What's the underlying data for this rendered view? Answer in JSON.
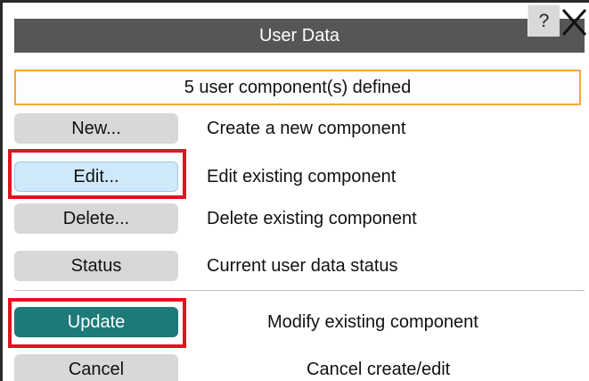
{
  "dialog": {
    "title": "User Data",
    "help_label": "?",
    "message": "5 user component(s) defined"
  },
  "options": [
    {
      "button": "New...",
      "description": "Create a new component"
    },
    {
      "button": "Edit...",
      "description": "Edit existing component",
      "selected": true
    },
    {
      "button": "Delete...",
      "description": "Delete existing component"
    },
    {
      "button": "Status",
      "description": "Current user data status"
    }
  ],
  "actions": [
    {
      "button": "Update",
      "description": "Modify existing component"
    },
    {
      "button": "Cancel",
      "description": "Cancel create/edit"
    }
  ],
  "colors": {
    "accent_teal": "#1d7a78",
    "selected_blue": "#cfe9fb",
    "message_border": "#f2a63d",
    "highlight_red": "#e3121f"
  }
}
